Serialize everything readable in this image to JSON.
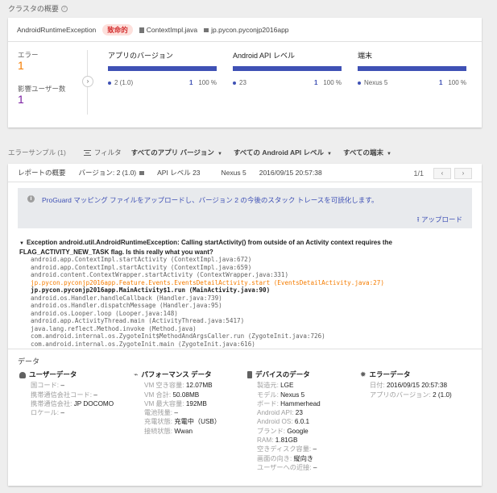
{
  "page_title": "クラスタの概要",
  "help_glyph": "?",
  "summary": {
    "exception": "AndroidRuntimeException",
    "severity": "致命的",
    "file": "ContextImpl.java",
    "package": "jp.pycon.pyconjp2016app",
    "errors_label": "エラー",
    "errors_value": "1",
    "users_label": "影響ユーザー数",
    "users_value": "1",
    "expand_glyph": "›",
    "columns": [
      {
        "title": "アプリのバージョン",
        "item": "2 (1.0)",
        "count": "1",
        "percent": "100 %"
      },
      {
        "title": "Android API レベル",
        "item": "23",
        "count": "1",
        "percent": "100 %"
      },
      {
        "title": "端末",
        "item": "Nexus 5",
        "count": "1",
        "percent": "100 %"
      }
    ]
  },
  "toolbar": {
    "samples_label": "エラーサンプル (1)",
    "filter_label": "フィルタ",
    "dropdown1": "すべてのアプリ バージョン",
    "dropdown2": "すべての Android API レベル",
    "dropdown3": "すべての端末"
  },
  "report": {
    "overview_label": "レポートの概要",
    "version": "バージョン: 2 (1.0)",
    "api": "API レベル 23",
    "device": "Nexus 5",
    "timestamp": "2016/09/15 20:57:38",
    "pager_text": "1/1",
    "prev_glyph": "‹",
    "next_glyph": "›"
  },
  "banner": {
    "info_glyph": "i",
    "text": "ProGuard マッピング ファイルをアップロードし、バージョン 2 の今後のスタック トレースを可読化します。",
    "upload": "アップロード"
  },
  "exception_title": "Exception android.util.AndroidRuntimeException: Calling startActivity() from outside of an Activity context requires the FLAG_ACTIVITY_NEW_TASK flag. Is this really what you want?",
  "trace": [
    "android.app.ContextImpl.startActivity (ContextImpl.java:672)",
    "android.app.ContextImpl.startActivity (ContextImpl.java:659)",
    "android.content.ContextWrapper.startActivity (ContextWrapper.java:331)",
    "jp.pycon.pyconjp2016app.Feature.Events.EventsDetailActivity.start (EventsDetailActivity.java:27)",
    "jp.pycon.pyconjp2016app.MainActivity$1.run (MainActivity.java:90)",
    "android.os.Handler.handleCallback (Handler.java:739)",
    "android.os.Handler.dispatchMessage (Handler.java:95)",
    "android.os.Looper.loop (Looper.java:148)",
    "android.app.ActivityThread.main (ActivityThread.java:5417)",
    "java.lang.reflect.Method.invoke (Method.java)",
    "com.android.internal.os.ZygoteInit$MethodAndArgsCaller.run (ZygoteInit.java:726)",
    "com.android.internal.os.ZygoteInit.main (ZygoteInit.java:616)"
  ],
  "data_section": {
    "title": "データ",
    "user": {
      "heading": "ユーザーデータ",
      "rows": [
        {
          "k": "国コード:",
          "v": "–"
        },
        {
          "k": "携帯通信会社コード:",
          "v": "–"
        },
        {
          "k": "携帯通信会社:",
          "v": "JP DOCOMO"
        },
        {
          "k": "ロケール:",
          "v": "–"
        }
      ]
    },
    "perf": {
      "heading": "パフォーマンス データ",
      "rows": [
        {
          "k": "VM 空き容量:",
          "v": "12.07MB"
        },
        {
          "k": "VM 合計:",
          "v": "50.08MB"
        },
        {
          "k": "VM 最大容量:",
          "v": "192MB"
        },
        {
          "k": "電池残量:",
          "v": "–"
        },
        {
          "k": "充電状態:",
          "v": "充電中（USB）"
        },
        {
          "k": "接続状態:",
          "v": "Wwan"
        }
      ]
    },
    "device": {
      "heading": "デバイスのデータ",
      "rows": [
        {
          "k": "製造元:",
          "v": "LGE"
        },
        {
          "k": "モデル:",
          "v": "Nexus 5"
        },
        {
          "k": "ボード:",
          "v": "Hammerhead"
        },
        {
          "k": "Android API:",
          "v": "23"
        },
        {
          "k": "Android OS:",
          "v": "6.0.1"
        },
        {
          "k": "ブランド:",
          "v": "Google"
        },
        {
          "k": "RAM:",
          "v": "1.81GB"
        },
        {
          "k": "空きディスク容量:",
          "v": "–"
        },
        {
          "k": "画面の向き:",
          "v": "縦向き"
        },
        {
          "k": "ユーザーへの近接:",
          "v": "–"
        }
      ]
    },
    "error": {
      "heading": "エラーデータ",
      "rows": [
        {
          "k": "日付:",
          "v": "2016/09/15 20:57:38"
        },
        {
          "k": "アプリのバージョン:",
          "v": "2 (1.0)"
        }
      ]
    }
  },
  "colors": {
    "accent": "#3f51b5",
    "danger": "#d32f2f",
    "highlight": "#f57c00"
  }
}
